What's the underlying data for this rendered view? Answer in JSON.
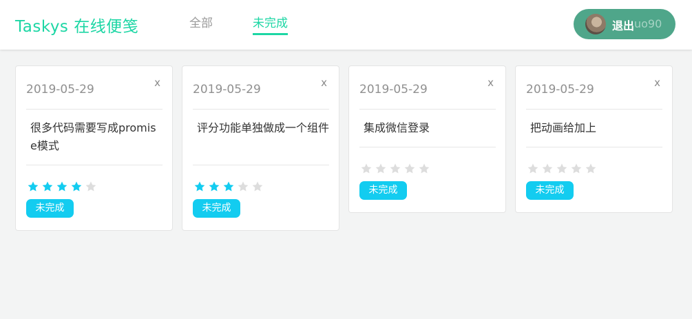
{
  "header": {
    "brand": "Taskys 在线便笺",
    "tabs": [
      {
        "label": "全部",
        "active": false
      },
      {
        "label": "未完成",
        "active": true
      }
    ],
    "logout_label": "退出",
    "username": "uo90"
  },
  "colors": {
    "brand": "#1cd6a4",
    "logout_bg": "#4fa68a",
    "star_on": "#13ccf0",
    "star_off": "#dddddd",
    "badge": "#13ccf0"
  },
  "cards": [
    {
      "date": "2019-05-29",
      "close": "x",
      "text": "很多代码需要写成promise模式",
      "rating": 4,
      "max_rating": 5,
      "status": "未完成"
    },
    {
      "date": "2019-05-29",
      "close": "x",
      "text": "评分功能单独做成一个组件",
      "rating": 3,
      "max_rating": 5,
      "status": "未完成"
    },
    {
      "date": "2019-05-29",
      "close": "x",
      "text": "集成微信登录",
      "rating": 0,
      "max_rating": 5,
      "status": "未完成"
    },
    {
      "date": "2019-05-29",
      "close": "x",
      "text": "把动画给加上",
      "rating": 0,
      "max_rating": 5,
      "status": "未完成"
    }
  ]
}
